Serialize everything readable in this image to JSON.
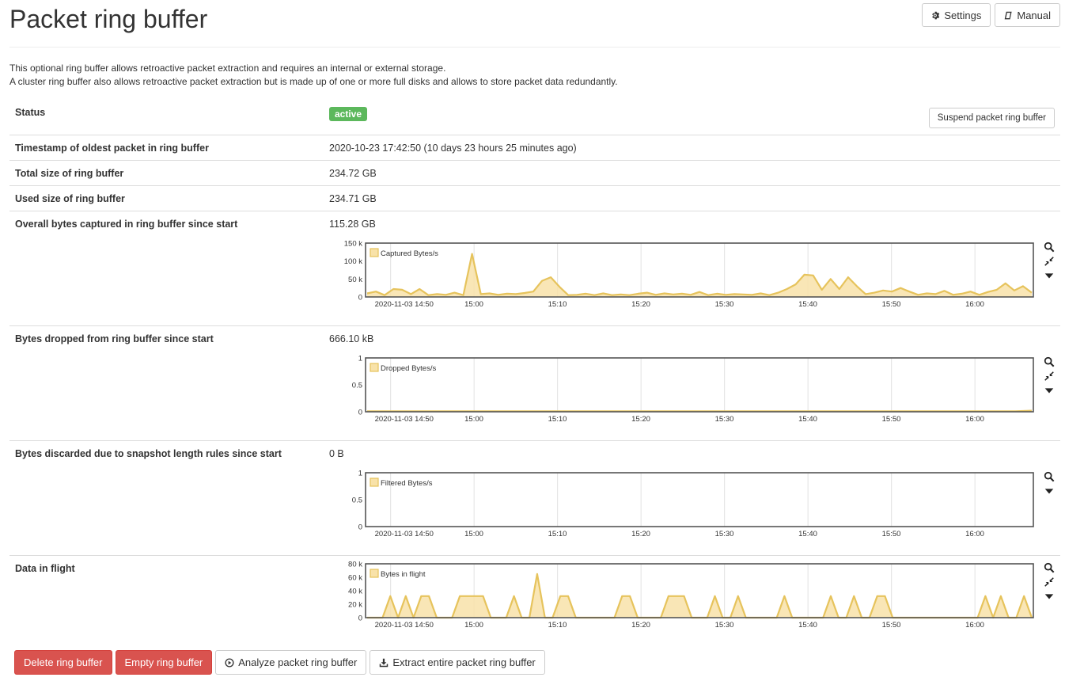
{
  "header": {
    "title": "Packet ring buffer",
    "settings_label": "Settings",
    "manual_label": "Manual"
  },
  "intro": {
    "line1": "This optional ring buffer allows retroactive packet extraction and requires an internal or external storage.",
    "line2": "A cluster ring buffer also allows retroactive packet extraction but is made up of one or more full disks and allows to store packet data redundantly."
  },
  "rows": {
    "status": {
      "label": "Status",
      "badge": "active",
      "button": "Suspend packet ring buffer"
    },
    "oldest": {
      "label": "Timestamp of oldest packet in ring buffer",
      "value": "2020-10-23 17:42:50 (10 days 23 hours 25 minutes ago)"
    },
    "total": {
      "label": "Total size of ring buffer",
      "value": "234.72 GB"
    },
    "used": {
      "label": "Used size of ring buffer",
      "value": "234.71 GB"
    },
    "captured": {
      "label": "Overall bytes captured in ring buffer since start",
      "value": "115.28 GB"
    },
    "dropped": {
      "label": "Bytes dropped from ring buffer since start",
      "value": "666.10 kB"
    },
    "discarded": {
      "label": "Bytes discarded due to snapshot length rules since start",
      "value": "0 B"
    },
    "inflight": {
      "label": "Data in flight"
    }
  },
  "colors": {
    "series_line": "#e6c35c",
    "series_fill": "#f8e2a9",
    "danger": "#d9534f",
    "success": "#5cb85c"
  },
  "icons": [
    "gear-icon",
    "book-icon",
    "zoom-icon",
    "compress-icon",
    "caret-down-icon",
    "play-circle-icon",
    "download-icon"
  ],
  "chart_data": [
    {
      "type": "area",
      "series": [
        {
          "name": "Captured Bytes/s",
          "values": [
            10000,
            15000,
            5000,
            22000,
            20000,
            8000,
            22000,
            5000,
            8000,
            6000,
            12000,
            5000,
            120000,
            8000,
            10000,
            6000,
            9000,
            8000,
            11000,
            15000,
            45000,
            55000,
            28000,
            5000,
            6000,
            9000,
            5000,
            10000,
            5000,
            7000,
            5000,
            9000,
            12000,
            6000,
            10000,
            7000,
            9000,
            6000,
            14000,
            5000,
            9000,
            6000,
            8000,
            7000,
            6000,
            10000,
            5000,
            12000,
            22000,
            35000,
            62000,
            60000,
            20000,
            50000,
            22000,
            55000,
            30000,
            8000,
            12000,
            18000,
            15000,
            25000,
            15000,
            6000,
            10000,
            8000,
            17000,
            6000,
            9000,
            15000,
            6000,
            14000,
            20000,
            38000,
            18000,
            30000,
            12000
          ]
        }
      ],
      "x_start": "2020-11-03 14:47",
      "x_end": "2020-11-03 16:07",
      "x_ticks": [
        "2020-11-03 14:50",
        "15:00",
        "15:10",
        "15:20",
        "15:30",
        "15:40",
        "15:50",
        "16:00"
      ],
      "y_ticks": [
        "150 k",
        "100 k",
        "50 k",
        "0"
      ],
      "ylim": [
        0,
        150000
      ],
      "legend_position": "top-left",
      "grid": true
    },
    {
      "type": "area",
      "series": [
        {
          "name": "Dropped Bytes/s",
          "values": [
            0.01,
            0.01,
            0.01,
            0.01,
            0.01,
            0.01,
            0.01,
            0.01,
            0.01,
            0.01,
            0.01,
            0.01,
            0.01,
            0.01,
            0.01,
            0.01,
            0.01,
            0.01,
            0.01,
            0.01,
            0.01,
            0.01,
            0.01,
            0.01,
            0.01,
            0.01,
            0.01,
            0.01,
            0.01,
            0.01,
            0.01,
            0.01,
            0.01,
            0.01,
            0.01,
            0.01,
            0.01,
            0.01,
            0.01,
            0.01,
            0.02
          ]
        }
      ],
      "x_start": "2020-11-03 14:47",
      "x_end": "2020-11-03 16:07",
      "x_ticks": [
        "2020-11-03 14:50",
        "15:00",
        "15:10",
        "15:20",
        "15:30",
        "15:40",
        "15:50",
        "16:00"
      ],
      "y_ticks": [
        "1",
        "0.5",
        "0"
      ],
      "ylim": [
        0,
        1
      ],
      "legend_position": "top-left",
      "grid": true
    },
    {
      "type": "area",
      "series": [
        {
          "name": "Filtered Bytes/s",
          "values": []
        }
      ],
      "x_start": "2020-11-03 14:47",
      "x_end": "2020-11-03 16:07",
      "x_ticks": [
        "2020-11-03 14:50",
        "15:00",
        "15:10",
        "15:20",
        "15:30",
        "15:40",
        "15:50",
        "16:00"
      ],
      "y_ticks": [
        "1",
        "0.5",
        "0"
      ],
      "ylim": [
        0,
        1
      ],
      "legend_position": "top-left",
      "grid": true
    },
    {
      "type": "area",
      "series": [
        {
          "name": "Bytes in flight",
          "values": [
            0,
            0,
            0,
            32000,
            0,
            32000,
            0,
            32000,
            32000,
            0,
            0,
            0,
            32000,
            32000,
            32000,
            32000,
            0,
            0,
            0,
            32000,
            0,
            0,
            65000,
            0,
            0,
            32000,
            32000,
            0,
            0,
            0,
            0,
            0,
            0,
            32000,
            32000,
            0,
            0,
            0,
            0,
            32000,
            32000,
            32000,
            0,
            0,
            0,
            32000,
            0,
            0,
            32000,
            0,
            0,
            0,
            0,
            0,
            32000,
            0,
            0,
            0,
            0,
            0,
            32000,
            0,
            0,
            32000,
            0,
            0,
            32000,
            32000,
            0,
            0,
            0,
            0,
            0,
            0,
            0,
            0,
            0,
            0,
            0,
            0,
            32000,
            0,
            32000,
            0,
            0,
            32000,
            0
          ]
        }
      ],
      "x_start": "2020-11-03 14:47",
      "x_end": "2020-11-03 16:07",
      "x_ticks": [
        "2020-11-03 14:50",
        "15:00",
        "15:10",
        "15:20",
        "15:30",
        "15:40",
        "15:50",
        "16:00"
      ],
      "y_ticks": [
        "80 k",
        "60 k",
        "40 k",
        "20 k",
        "0"
      ],
      "ylim": [
        0,
        80000
      ],
      "legend_position": "top-left",
      "grid": true
    }
  ],
  "footer": {
    "delete_label": "Delete ring buffer",
    "empty_label": "Empty ring buffer",
    "analyze_label": "Analyze packet ring buffer",
    "extract_label": "Extract entire packet ring buffer"
  }
}
